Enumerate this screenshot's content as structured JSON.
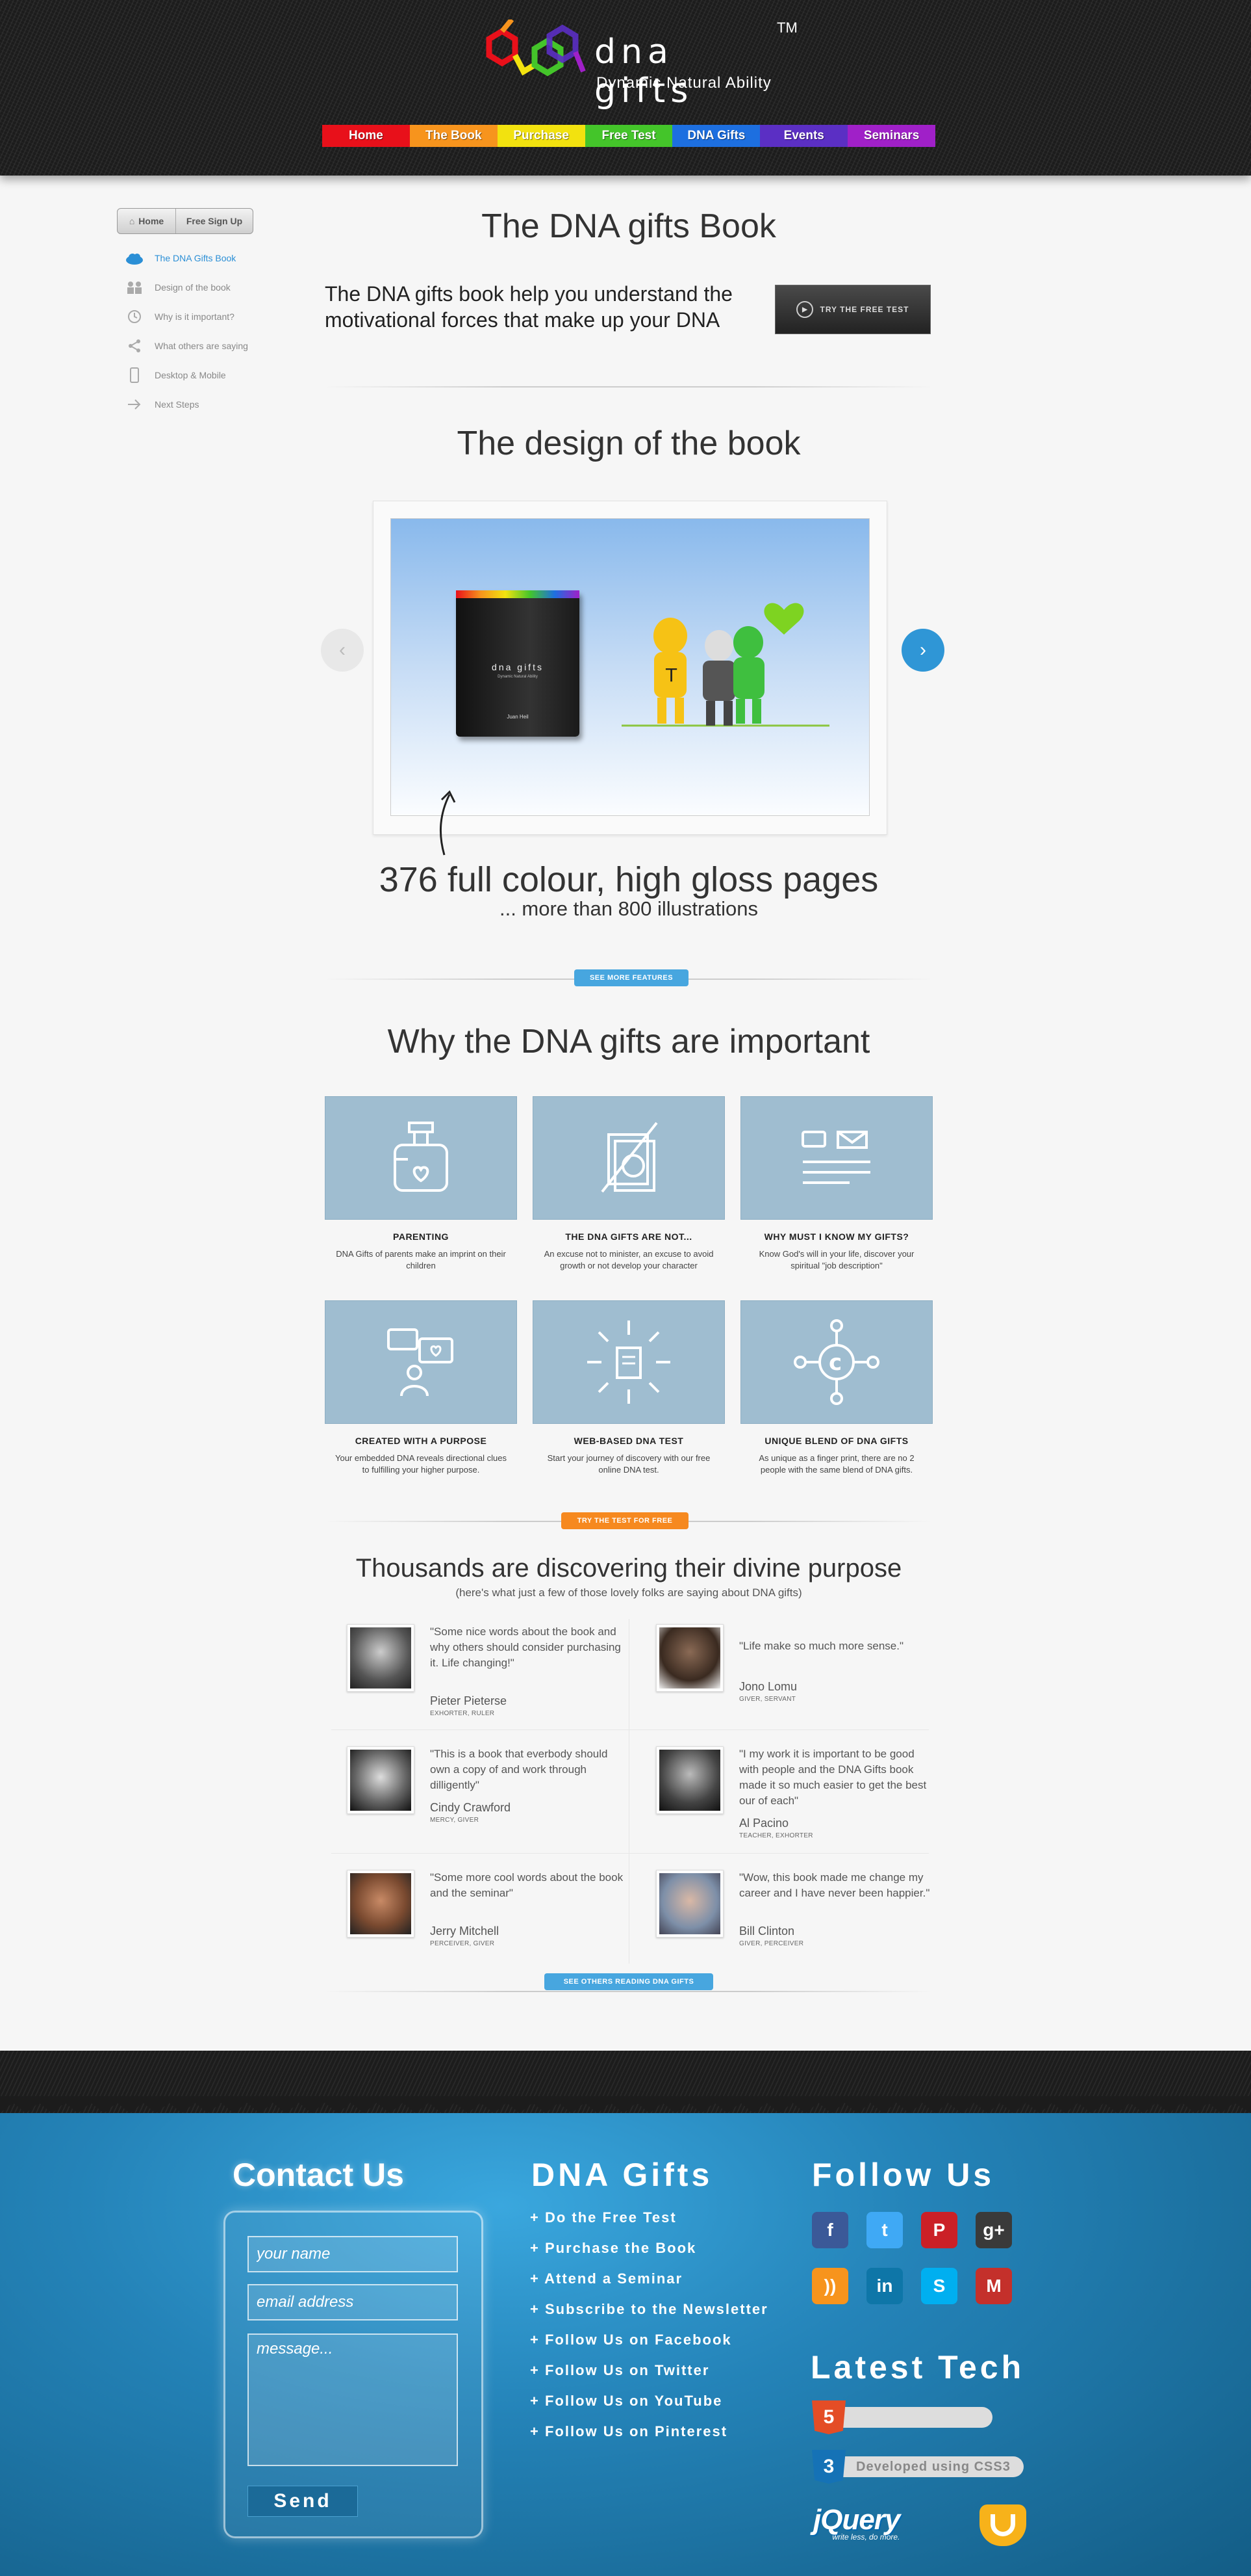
{
  "logo": {
    "brand": "dna gifts",
    "tagline": "Dynamic Natural Ability",
    "tm": "TM"
  },
  "nav": [
    {
      "label": "Home",
      "color": "#e8101a"
    },
    {
      "label": "The Book",
      "color": "#f7941d"
    },
    {
      "label": "Purchase",
      "color": "#f2e20f"
    },
    {
      "label": "Free Test",
      "color": "#44c52a"
    },
    {
      "label": "DNA Gifts",
      "color": "#1d6fe0"
    },
    {
      "label": "Events",
      "color": "#5b2fc4"
    },
    {
      "label": "Seminars",
      "color": "#a020c8"
    }
  ],
  "sidebar": {
    "home": "Home",
    "signup": "Free Sign Up",
    "items": [
      {
        "label": "The DNA Gifts Book",
        "icon": "cloud-icon"
      },
      {
        "label": "Design of the book",
        "icon": "people-icon"
      },
      {
        "label": "Why is it important?",
        "icon": "history-icon"
      },
      {
        "label": "What others are saying",
        "icon": "share-icon"
      },
      {
        "label": "Desktop & Mobile",
        "icon": "mobile-icon"
      },
      {
        "label": "Next Steps",
        "icon": "arrow-right-icon"
      }
    ]
  },
  "intro": {
    "title": "The DNA gifts Book",
    "text": "The DNA gifts book help you understand the motivational forces that make up your DNA",
    "try_button": "TRY THE FREE TEST"
  },
  "design": {
    "title": "The design of the book",
    "book_brand": "dna gifts",
    "book_tagline": "Dynamic Natural Ability",
    "book_author": "Juan Heil",
    "caption": "376 full colour, high gloss pages",
    "subcaption": "... more than 800 illustrations",
    "features_button": "SEE MORE FEATURES"
  },
  "important": {
    "title": "Why the DNA gifts are important",
    "features": [
      {
        "title": "PARENTING",
        "desc": "DNA Gifts of parents make an imprint on their children",
        "icon": "baby-bottle-icon"
      },
      {
        "title": "THE DNA GIFTS ARE NOT...",
        "desc": "An excuse not to minister, an excuse to avoid growth or not develop your character",
        "icon": "no-documents-icon"
      },
      {
        "title": "WHY MUST I KNOW MY GIFTS?",
        "desc": "Know God's will in your life, discover your spiritual \"job description\"",
        "icon": "message-icon"
      },
      {
        "title": "CREATED WITH A PURPOSE",
        "desc": "Your embedded DNA reveals directional clues to fulfilling your higher purpose.",
        "icon": "speech-heart-icon"
      },
      {
        "title": "WEB-BASED DNA TEST",
        "desc": "Start your journey of discovery with our free online DNA test.",
        "icon": "document-spark-icon"
      },
      {
        "title": "UNIQUE BLEND OF DNA GIFTS",
        "desc": "As unique as a finger print, there are no 2 people with the same blend of DNA gifts.",
        "icon": "network-icon"
      }
    ],
    "test_button": "TRY THE TEST FOR FREE"
  },
  "testimonials": {
    "title": "Thousands are discovering their divine purpose",
    "subtitle": "(here's what just a few of those lovely folks are saying about DNA gifts)",
    "items": [
      {
        "quote": "\"Some nice words about the book and why others should consider purchasing it. Life changing!\"",
        "name": "Pieter Pieterse",
        "role": "EXHORTER, RULER"
      },
      {
        "quote": "\"Life make so much more sense.\"",
        "name": "Jono Lomu",
        "role": "GIVER, SERVANT"
      },
      {
        "quote": "\"This is a book that everbody should own a copy of and work through dilligently\"",
        "name": "Cindy Crawford",
        "role": "MERCY, GIVER"
      },
      {
        "quote": "\"I my work it is important to be good with people and the DNA Gifts book made it so much easier to get the best our of each\"",
        "name": "Al Pacino",
        "role": "TEACHER, EXHORTER"
      },
      {
        "quote": "\"Some more cool words about the book and the seminar\"",
        "name": "Jerry Mitchell",
        "role": "PERCEIVER, GIVER"
      },
      {
        "quote": "\"Wow, this book made me change my career and I have never been happier.\"",
        "name": "Bill Clinton",
        "role": "GIVER, PERCEIVER"
      }
    ],
    "others_button": "SEE OTHERS READING DNA GIFTS"
  },
  "footer": {
    "contact_title": "Contact Us",
    "name_placeholder": "your name",
    "email_placeholder": "email address",
    "message_placeholder": "message...",
    "send": "Send",
    "links_title": "DNA Gifts",
    "links": [
      "+ Do the Free Test",
      "+ Purchase the Book",
      "+ Attend a Seminar",
      "+ Subscribe to the Newsletter",
      "+ Follow Us on Facebook",
      "+ Follow Us on Twitter",
      "+ Follow Us on YouTube",
      "+ Follow Us on Pinterest"
    ],
    "follow_title": "Follow Us",
    "social": [
      {
        "name": "facebook-icon",
        "glyph": "f",
        "color": "#3b5998"
      },
      {
        "name": "twitter-icon",
        "glyph": "t",
        "color": "#3fa9f5"
      },
      {
        "name": "pinterest-icon",
        "glyph": "P",
        "color": "#cb2027"
      },
      {
        "name": "google-plus-icon",
        "glyph": "g+",
        "color": "#3a3a3a"
      },
      {
        "name": "rss-icon",
        "glyph": "))",
        "color": "#f7941d"
      },
      {
        "name": "linkedin-icon",
        "glyph": "in",
        "color": "#0e76a8"
      },
      {
        "name": "skype-icon",
        "glyph": "S",
        "color": "#00aff0"
      },
      {
        "name": "gmail-icon",
        "glyph": "M",
        "color": "#c4302b"
      }
    ],
    "tech_title": "Latest Tech",
    "css3_badge": "Developed using CSS3",
    "jquery": "jQuery",
    "jquery_tag": "write less, do more."
  }
}
